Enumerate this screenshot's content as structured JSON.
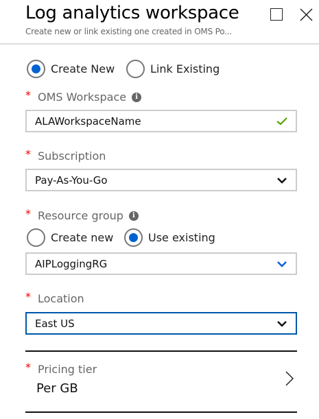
{
  "header": {
    "title": "Log analytics workspace",
    "subtitle": "Create new or link existing one created in OMS Po..."
  },
  "workspace_mode": {
    "options": [
      "Create New",
      "Link Existing"
    ],
    "selected": "Create New"
  },
  "oms_workspace": {
    "label": "OMS Workspace",
    "value": "ALAWorkspaceName",
    "valid": true
  },
  "subscription": {
    "label": "Subscription",
    "value": "Pay-As-You-Go"
  },
  "resource_group": {
    "label": "Resource group",
    "options": [
      "Create new",
      "Use existing"
    ],
    "selected": "Use existing",
    "value": "AIPLoggingRG"
  },
  "location": {
    "label": "Location",
    "value": "East US"
  },
  "pricing_tier": {
    "label": "Pricing tier",
    "value": "Per GB"
  },
  "colors": {
    "accent": "#0063d1",
    "required": "#e00000",
    "valid": "#57a300",
    "focus_border": "#0058a8"
  }
}
